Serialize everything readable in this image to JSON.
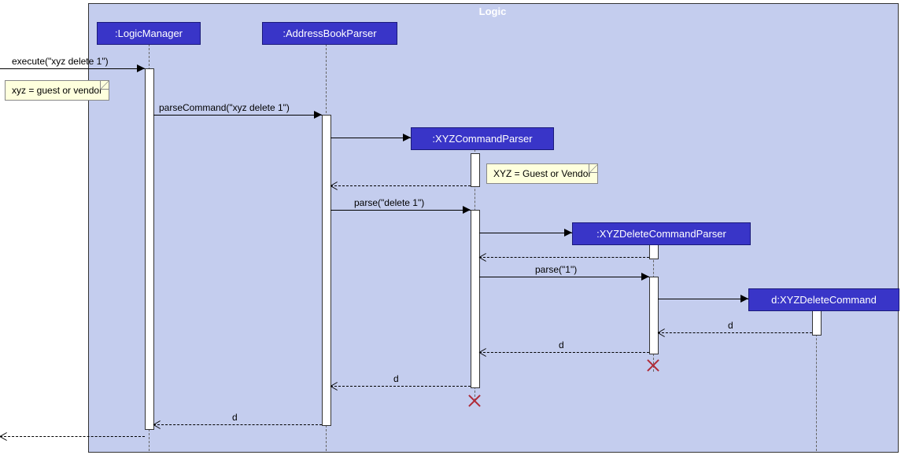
{
  "frame": {
    "title": "Logic"
  },
  "participants": {
    "logicManager": ":LogicManager",
    "addressBookParser": ":AddressBookParser",
    "xyzCommandParser": ":XYZCommandParser",
    "xyzDeleteCommandParser": ":XYZDeleteCommandParser",
    "xyzDeleteCommand": "d:XYZDeleteCommand"
  },
  "notes": {
    "note1": "xyz = guest or vendor",
    "note2": "XYZ = Guest or Vendor"
  },
  "messages": {
    "m1": "execute(\"xyz delete 1\")",
    "m2": "parseCommand(\"xyz delete 1\")",
    "m3": "parse(\"delete 1\")",
    "m4": "parse(\"1\")",
    "r1": "d",
    "r2": "d",
    "r3": "d",
    "r4": "d"
  },
  "chart_data": {
    "type": "sequence-diagram",
    "frame": "Logic",
    "actors": [
      "(external)",
      ":LogicManager",
      ":AddressBookParser",
      ":XYZCommandParser",
      ":XYZDeleteCommandParser",
      "d:XYZDeleteCommand"
    ],
    "messages": [
      {
        "from": "(external)",
        "to": ":LogicManager",
        "label": "execute(\"xyz delete 1\")",
        "type": "sync"
      },
      {
        "note": "xyz = guest or vendor",
        "attached_to": ":LogicManager"
      },
      {
        "from": ":LogicManager",
        "to": ":AddressBookParser",
        "label": "parseCommand(\"xyz delete 1\")",
        "type": "sync"
      },
      {
        "from": ":AddressBookParser",
        "to": ":XYZCommandParser",
        "label": "",
        "type": "create"
      },
      {
        "note": "XYZ = Guest or Vendor",
        "attached_to": ":XYZCommandParser"
      },
      {
        "from": ":XYZCommandParser",
        "to": ":AddressBookParser",
        "label": "",
        "type": "return"
      },
      {
        "from": ":AddressBookParser",
        "to": ":XYZCommandParser",
        "label": "parse(\"delete 1\")",
        "type": "sync"
      },
      {
        "from": ":XYZCommandParser",
        "to": ":XYZDeleteCommandParser",
        "label": "",
        "type": "create"
      },
      {
        "from": ":XYZDeleteCommandParser",
        "to": ":XYZCommandParser",
        "label": "",
        "type": "return"
      },
      {
        "from": ":XYZCommandParser",
        "to": ":XYZDeleteCommandParser",
        "label": "parse(\"1\")",
        "type": "sync"
      },
      {
        "from": ":XYZDeleteCommandParser",
        "to": "d:XYZDeleteCommand",
        "label": "",
        "type": "create"
      },
      {
        "from": "d:XYZDeleteCommand",
        "to": ":XYZDeleteCommandParser",
        "label": "d",
        "type": "return"
      },
      {
        "from": ":XYZDeleteCommandParser",
        "to": ":XYZCommandParser",
        "label": "d",
        "type": "return"
      },
      {
        "destroy": ":XYZDeleteCommandParser"
      },
      {
        "from": ":XYZCommandParser",
        "to": ":AddressBookParser",
        "label": "d",
        "type": "return"
      },
      {
        "destroy": ":XYZCommandParser"
      },
      {
        "from": ":AddressBookParser",
        "to": ":LogicManager",
        "label": "d",
        "type": "return"
      },
      {
        "from": ":LogicManager",
        "to": "(external)",
        "label": "",
        "type": "return"
      }
    ]
  }
}
